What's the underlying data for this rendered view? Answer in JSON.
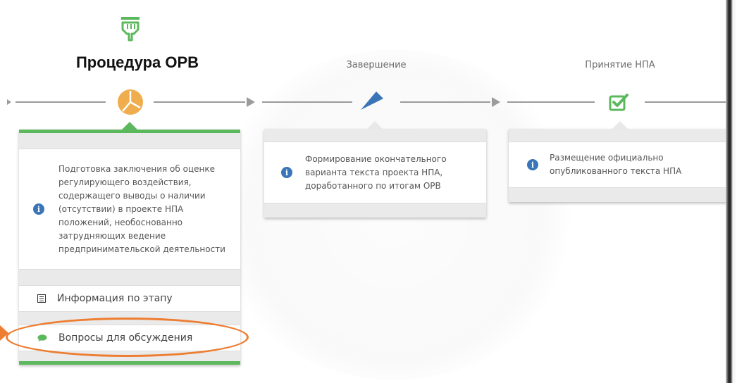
{
  "stages": [
    {
      "title": "Процедура ОРВ",
      "active": true,
      "icon": "pie-chart-icon",
      "description": "Подготовка заключения об оценке регулирующего воздействия, содержащего выводы о наличии (отсутствии) в проекте НПА положений, необоснованно затрудняющих ведение предпринимательской деятельности",
      "description_lines": [
        "Подготовка заключения об оценке",
        "регулирующего воздействия,",
        "содержащего выводы о наличии",
        "(отсутствии) в проекте НПА",
        "положений, необоснованно",
        "затрудняющих ведение",
        "предпринимательской деятельности"
      ],
      "menu": [
        {
          "label": "Информация по этапу",
          "icon": "document-list-icon"
        },
        {
          "label": "Вопросы для обсуждения",
          "icon": "chat-bubble-icon"
        }
      ]
    },
    {
      "title": "Завершение",
      "active": false,
      "icon": "flag-arrow-icon",
      "description_lines": [
        "Формирование окончательного",
        "варианта текста проекта НПА,",
        "доработанного по итогам ОРВ"
      ]
    },
    {
      "title": "Принятие НПА",
      "active": false,
      "icon": "checkbox-checked-icon",
      "description_lines": [
        "Размещение официально",
        "опубликованного текста НПА"
      ]
    }
  ],
  "colors": {
    "active_green": "#5cb85c",
    "pie_orange": "#f0ad4e",
    "info_blue": "#3a75b7",
    "highlight_orange": "#ed7d31",
    "flag_blue": "#3a75b7"
  },
  "annotation": {
    "type": "ellipse-highlight",
    "target": "Вопросы для обсуждения"
  }
}
